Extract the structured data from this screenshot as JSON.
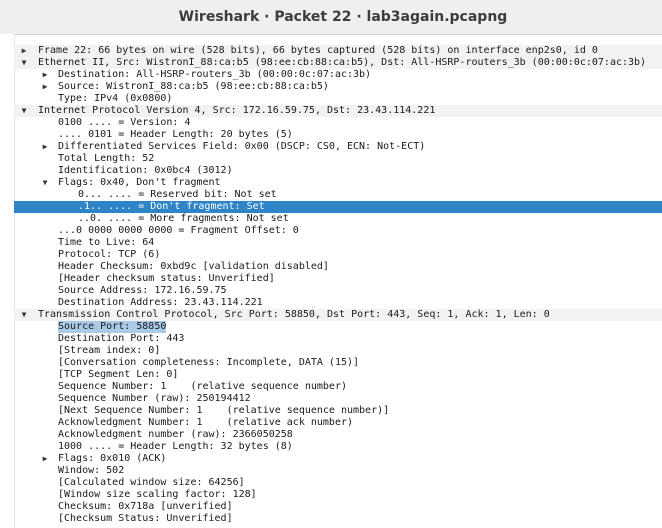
{
  "window": {
    "title": "Wireshark · Packet 22 · lab3again.pcapng"
  },
  "icons": {
    "collapsed": "▶",
    "expanded": "▼"
  },
  "rows": [
    {
      "text": "Frame 22: 66 bytes on wire (528 bits), 66 bytes captured (528 bits) on interface enp2s0, id 0",
      "level": 0,
      "toggle": "collapsed",
      "style": "header"
    },
    {
      "text": "Ethernet II, Src: WistronI_88:ca:b5 (98:ee:cb:88:ca:b5), Dst: All-HSRP-routers_3b (00:00:0c:07:ac:3b)",
      "level": 0,
      "toggle": "expanded",
      "style": "header"
    },
    {
      "text": "Destination: All-HSRP-routers_3b (00:00:0c:07:ac:3b)",
      "level": 1,
      "toggle": "collapsed"
    },
    {
      "text": "Source: WistronI_88:ca:b5 (98:ee:cb:88:ca:b5)",
      "level": 1,
      "toggle": "collapsed"
    },
    {
      "text": "Type: IPv4 (0x0800)",
      "level": 1
    },
    {
      "text": "Internet Protocol Version 4, Src: 172.16.59.75, Dst: 23.43.114.221",
      "level": 0,
      "toggle": "expanded",
      "style": "header"
    },
    {
      "text": "0100 .... = Version: 4",
      "level": 1
    },
    {
      "text": ".... 0101 = Header Length: 20 bytes (5)",
      "level": 1
    },
    {
      "text": "Differentiated Services Field: 0x00 (DSCP: CS0, ECN: Not-ECT)",
      "level": 1,
      "toggle": "collapsed"
    },
    {
      "text": "Total Length: 52",
      "level": 1
    },
    {
      "text": "Identification: 0x0bc4 (3012)",
      "level": 1
    },
    {
      "text": "Flags: 0x40, Don't fragment",
      "level": 1,
      "toggle": "expanded"
    },
    {
      "text": "0... .... = Reserved bit: Not set",
      "level": 2
    },
    {
      "text": ".1.. .... = Don't fragment: Set",
      "level": 2,
      "style": "sel"
    },
    {
      "text": "..0. .... = More fragments: Not set",
      "level": 2
    },
    {
      "text": "...0 0000 0000 0000 = Fragment Offset: 0",
      "level": 1
    },
    {
      "text": "Time to Live: 64",
      "level": 1
    },
    {
      "text": "Protocol: TCP (6)",
      "level": 1
    },
    {
      "text": "Header Checksum: 0xbd9c [validation disabled]",
      "level": 1
    },
    {
      "text": "[Header checksum status: Unverified]",
      "level": 1
    },
    {
      "text": "Source Address: 172.16.59.75",
      "level": 1
    },
    {
      "text": "Destination Address: 23.43.114.221",
      "level": 1
    },
    {
      "text": "Transmission Control Protocol, Src Port: 58850, Dst Port: 443, Seq: 1, Ack: 1, Len: 0",
      "level": 0,
      "toggle": "expanded",
      "style": "header"
    },
    {
      "text": "Source Port: 58850",
      "level": 1,
      "style": "hl"
    },
    {
      "text": "Destination Port: 443",
      "level": 1
    },
    {
      "text": "[Stream index: 0]",
      "level": 1
    },
    {
      "text": "[Conversation completeness: Incomplete, DATA (15)]",
      "level": 1
    },
    {
      "text": "[TCP Segment Len: 0]",
      "level": 1
    },
    {
      "text": "Sequence Number: 1    (relative sequence number)",
      "level": 1
    },
    {
      "text": "Sequence Number (raw): 250194412",
      "level": 1
    },
    {
      "text": "[Next Sequence Number: 1    (relative sequence number)]",
      "level": 1
    },
    {
      "text": "Acknowledgment Number: 1    (relative ack number)",
      "level": 1
    },
    {
      "text": "Acknowledgment number (raw): 2366050258",
      "level": 1
    },
    {
      "text": "1000 .... = Header Length: 32 bytes (8)",
      "level": 1
    },
    {
      "text": "Flags: 0x010 (ACK)",
      "level": 1,
      "toggle": "collapsed"
    },
    {
      "text": "Window: 502",
      "level": 1
    },
    {
      "text": "[Calculated window size: 64256]",
      "level": 1
    },
    {
      "text": "[Window size scaling factor: 128]",
      "level": 1
    },
    {
      "text": "Checksum: 0x718a [unverified]",
      "level": 1
    },
    {
      "text": "[Checksum Status: Unverified]",
      "level": 1
    }
  ]
}
